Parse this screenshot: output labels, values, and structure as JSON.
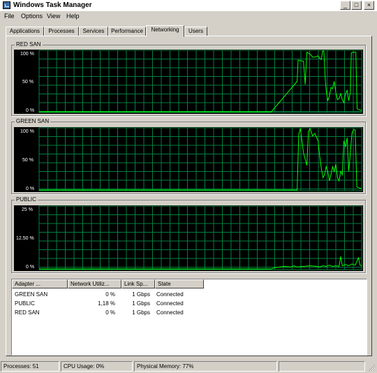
{
  "window": {
    "title": "Windows Task Manager"
  },
  "menu": [
    "File",
    "Options",
    "View",
    "Help"
  ],
  "tabs": [
    "Applications",
    "Processes",
    "Services",
    "Performance",
    "Networking",
    "Users"
  ],
  "active_tab": 4,
  "graphs": [
    {
      "name": "RED SAN",
      "y_labels": [
        "100 %",
        "50 %",
        "0 %"
      ],
      "series": [
        [
          0,
          0
        ],
        [
          72,
          0
        ],
        [
          80,
          0.5
        ],
        [
          80.3,
          0.85
        ],
        [
          82,
          0.83
        ],
        [
          82.5,
          0.45
        ],
        [
          83,
          0.98
        ],
        [
          84,
          0.95
        ],
        [
          84.8,
          0.9
        ],
        [
          85.5,
          0.9
        ],
        [
          86.5,
          0.92
        ],
        [
          87,
          0.88
        ],
        [
          87.5,
          0.86
        ],
        [
          87.9,
          1.0
        ],
        [
          88.3,
          1.0
        ],
        [
          88.7,
          0.55
        ],
        [
          89,
          0.35
        ],
        [
          89.5,
          0.18
        ],
        [
          90,
          0.26
        ],
        [
          90.5,
          0.4
        ],
        [
          91,
          0.38
        ],
        [
          91.5,
          0.5
        ],
        [
          92,
          0.32
        ],
        [
          92.5,
          0.2
        ],
        [
          93,
          0.22
        ],
        [
          93.5,
          0.3
        ],
        [
          94,
          0.2
        ],
        [
          94.5,
          0.15
        ],
        [
          95,
          0.3
        ],
        [
          95.5,
          0.35
        ],
        [
          96,
          0.18
        ],
        [
          96.5,
          0.32
        ],
        [
          96.8,
          0.97
        ],
        [
          97.5,
          0.98
        ],
        [
          98.2,
          0.98
        ],
        [
          98.6,
          0.05
        ],
        [
          100,
          0.02
        ]
      ]
    },
    {
      "name": "GREEN SAN",
      "y_labels": [
        "100 %",
        "50 %",
        "0 %"
      ],
      "series": [
        [
          0,
          0
        ],
        [
          80,
          0
        ],
        [
          80.5,
          0.9
        ],
        [
          81,
          1.0
        ],
        [
          82,
          0.6
        ],
        [
          83,
          0.4
        ],
        [
          83.5,
          0.95
        ],
        [
          84,
          1.0
        ],
        [
          84.8,
          0.88
        ],
        [
          85.5,
          0.92
        ],
        [
          86.5,
          0.8
        ],
        [
          87,
          0.55
        ],
        [
          87.5,
          0.35
        ],
        [
          88,
          0.2
        ],
        [
          88.5,
          0.25
        ],
        [
          89,
          0.38
        ],
        [
          89.5,
          0.3
        ],
        [
          90,
          0.15
        ],
        [
          90.5,
          0.25
        ],
        [
          91,
          0.38
        ],
        [
          91.5,
          0.3
        ],
        [
          92,
          0.42
        ],
        [
          92.5,
          0.2
        ],
        [
          93,
          0.15
        ],
        [
          93.5,
          0.3
        ],
        [
          94,
          0.25
        ],
        [
          94.5,
          0.8
        ],
        [
          95,
          0.7
        ],
        [
          95.5,
          0.85
        ],
        [
          96,
          0.3
        ],
        [
          96.5,
          0.6
        ],
        [
          97,
          0.92
        ],
        [
          97.5,
          0.98
        ],
        [
          98,
          0.98
        ],
        [
          98.5,
          0.05
        ],
        [
          100,
          0.02
        ]
      ]
    },
    {
      "name": "PUBLIC",
      "y_labels": [
        "25 %",
        "12.50 %",
        "0 %"
      ],
      "series": [
        [
          0,
          0
        ],
        [
          72,
          0
        ],
        [
          73,
          0.02
        ],
        [
          76,
          0.04
        ],
        [
          78,
          0.03
        ],
        [
          79,
          0.05
        ],
        [
          80,
          0.03
        ],
        [
          82,
          0.04
        ],
        [
          84,
          0.05
        ],
        [
          86,
          0.04
        ],
        [
          87,
          0.03
        ],
        [
          88,
          0.05
        ],
        [
          89,
          0.04
        ],
        [
          90,
          0.06
        ],
        [
          91,
          0.04
        ],
        [
          92,
          0.05
        ],
        [
          93,
          0.04
        ],
        [
          93.5,
          0.2
        ],
        [
          94,
          0.05
        ],
        [
          95,
          0.07
        ],
        [
          96,
          0.05
        ],
        [
          97,
          0.08
        ],
        [
          98,
          0.06
        ],
        [
          99,
          0.18
        ],
        [
          99.5,
          0.06
        ],
        [
          100,
          0.05
        ]
      ]
    }
  ],
  "list": {
    "headers": [
      "Adapter ...",
      "Network Utiliz...",
      "Link Sp...",
      "State"
    ],
    "rows": [
      {
        "adapter": "GREEN SAN",
        "util": "0 %",
        "speed": "1 Gbps",
        "state": "Connected"
      },
      {
        "adapter": "PUBLIC",
        "util": "1,18 %",
        "speed": "1 Gbps",
        "state": "Connected"
      },
      {
        "adapter": "RED SAN",
        "util": "0 %",
        "speed": "1 Gbps",
        "state": "Connected"
      }
    ]
  },
  "status": {
    "processes": "Processes: 51",
    "cpu": "CPU Usage: 0%",
    "memory": "Physical Memory: 77%"
  },
  "colors": {
    "graph_bg": "#000000",
    "grid": "#008040",
    "line": "#00ff00"
  }
}
